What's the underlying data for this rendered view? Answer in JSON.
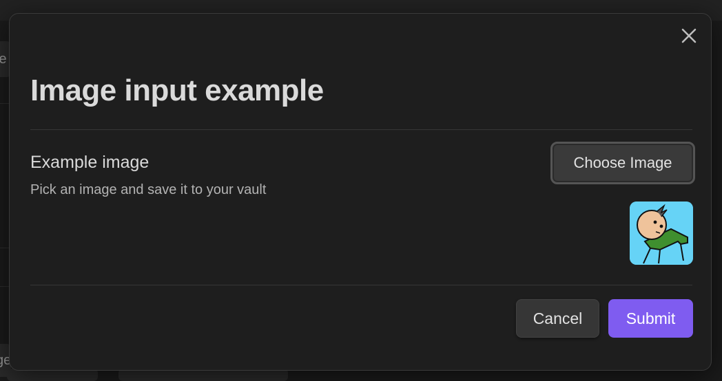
{
  "background": {
    "chip_top_text": "ie",
    "chip_bottom_text": "ge"
  },
  "modal": {
    "title": "Image input example",
    "close_icon": "close-icon",
    "setting": {
      "name": "Example image",
      "description": "Pick an image and save it to your vault",
      "choose_button_label": "Choose Image",
      "preview_icon": "cartoon-character-image"
    },
    "footer": {
      "cancel_label": "Cancel",
      "submit_label": "Submit"
    }
  },
  "colors": {
    "accent": "#7f5cf0",
    "modal_background": "#1e1e1e",
    "text_primary": "#dadada",
    "text_muted": "#b3b3b3"
  }
}
